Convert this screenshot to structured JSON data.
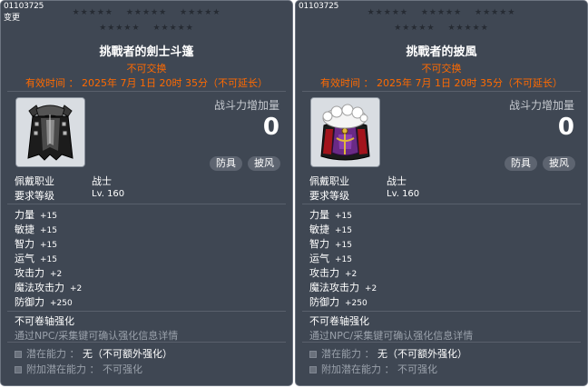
{
  "panels": [
    {
      "item_id": "01103725",
      "change_tag": "变更",
      "stars_row1": [
        "★★★★★",
        "★★★★★",
        "★★★★★"
      ],
      "stars_row2": [
        "★★★★★",
        "★★★★★"
      ],
      "name": "挑戰者的劍士斗篷",
      "untradeable": "不可交换",
      "expiry": "有效时间 ： 2025年 7月 1日 20时 35分（不可延长）",
      "icon": "warrior-cape-icon",
      "cp_label": "战斗力增加量",
      "cp_value": "0",
      "tag_type": "防具",
      "tag_sub": "披风",
      "job_label": "佩戴职业",
      "job_value": "战士",
      "level_label": "要求等级",
      "level_value": "Lv. 160",
      "stats": [
        {
          "label": "力量",
          "value": "+15"
        },
        {
          "label": "敏捷",
          "value": "+15"
        },
        {
          "label": "智力",
          "value": "+15"
        },
        {
          "label": "运气",
          "value": "+15"
        },
        {
          "label": "攻击力",
          "value": "+2"
        },
        {
          "label": "魔法攻击力",
          "value": "+2"
        },
        {
          "label": "防御力",
          "value": "+250"
        }
      ],
      "no_scroll": "不可卷轴强化",
      "npc_hint": "通过NPC/采集键可确认强化信息详情",
      "potential_label": "潜在能力 ：",
      "potential_value": "无（不可额外强化）",
      "bonus_label": "附加潜在能力 ：",
      "bonus_value": "不可强化"
    },
    {
      "item_id": "01103725",
      "stars_row1": [
        "★★★★★",
        "★★★★★",
        "★★★★★"
      ],
      "stars_row2": [
        "★★★★★",
        "★★★★★"
      ],
      "name": "挑戰者的披風",
      "untradeable": "不可交换",
      "expiry": "有效时间 ： 2025年 7月 1日 20时 35分（不可延长）",
      "icon": "fur-collar-cape-icon",
      "cp_label": "战斗力增加量",
      "cp_value": "0",
      "tag_type": "防具",
      "tag_sub": "披风",
      "job_label": "佩戴职业",
      "job_value": "战士",
      "level_label": "要求等级",
      "level_value": "Lv. 160",
      "stats": [
        {
          "label": "力量",
          "value": "+15"
        },
        {
          "label": "敏捷",
          "value": "+15"
        },
        {
          "label": "智力",
          "value": "+15"
        },
        {
          "label": "运气",
          "value": "+15"
        },
        {
          "label": "攻击力",
          "value": "+2"
        },
        {
          "label": "魔法攻击力",
          "value": "+2"
        },
        {
          "label": "防御力",
          "value": "+250"
        }
      ],
      "no_scroll": "不可卷轴强化",
      "npc_hint": "通过NPC/采集键可确认强化信息详情",
      "potential_label": "潜在能力 ：",
      "potential_value": "无（不可额外强化）",
      "bonus_label": "附加潜在能力 ：",
      "bonus_value": "不可强化"
    }
  ],
  "colors": {
    "panel_bg": "#3f4753",
    "warning": "#ff6a00",
    "muted_text": "#9aa1ab",
    "tag_bg": "#5d6470"
  }
}
